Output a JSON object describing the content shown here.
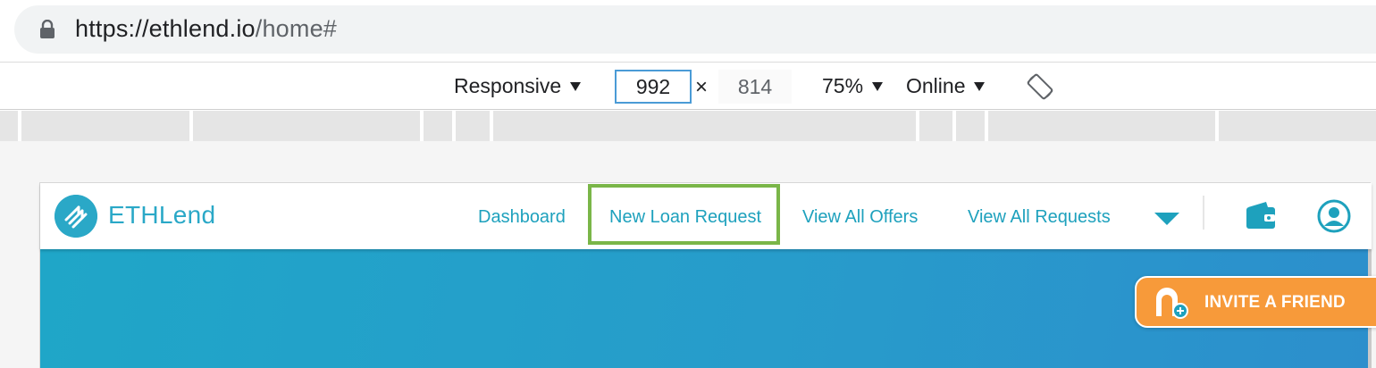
{
  "browser": {
    "url_main": "https://ethlend.io",
    "url_rest": "/home#",
    "lock_icon": "lock-icon"
  },
  "device_toolbar": {
    "device": "Responsive",
    "width": "992",
    "times": "×",
    "height": "814",
    "zoom": "75%",
    "network": "Online",
    "rotate_icon": "rotate-icon"
  },
  "navbar": {
    "brand": "ETHLend",
    "links": {
      "dashboard": "Dashboard",
      "new_loan": "New Loan Request",
      "view_offers": "View All Offers",
      "view_requests": "View All Requests"
    },
    "icons": [
      "logo-icon",
      "chevron-down-icon",
      "wallet-icon",
      "user-icon"
    ]
  },
  "invite": {
    "label": "INVITE A FRIEND",
    "icon": "add-friend-icon"
  },
  "colors": {
    "brand": "#2aa8c7",
    "link": "#1ea1bd",
    "highlight": "#7ab648",
    "hero_start": "#1fa6c8",
    "hero_end": "#2c8fcc",
    "invite": "#f79a3a"
  }
}
